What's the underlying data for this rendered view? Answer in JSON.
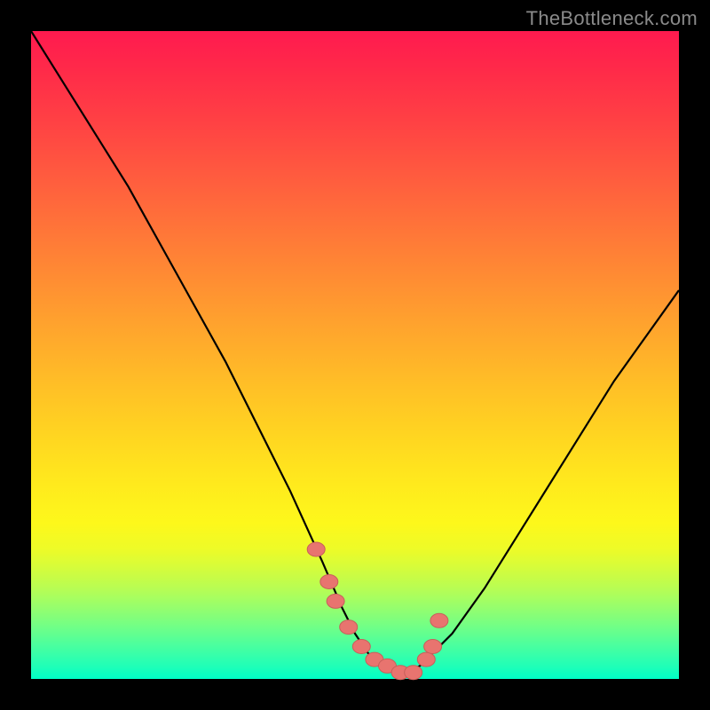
{
  "watermark": "TheBottleneck.com",
  "colors": {
    "curve_stroke": "#000000",
    "marker_fill": "#e8746f",
    "marker_stroke": "#c75f5a",
    "frame_bg": "#000000"
  },
  "chart_data": {
    "type": "line",
    "title": "",
    "xlabel": "",
    "ylabel": "",
    "xlim": [
      0,
      100
    ],
    "ylim": [
      0,
      100
    ],
    "series": [
      {
        "name": "bottleneck-curve",
        "x": [
          0,
          5,
          10,
          15,
          20,
          25,
          30,
          35,
          40,
          45,
          48,
          50,
          52,
          54,
          56,
          58,
          60,
          65,
          70,
          75,
          80,
          85,
          90,
          95,
          100
        ],
        "y": [
          100,
          92,
          84,
          76,
          67,
          58,
          49,
          39,
          29,
          18,
          11,
          7,
          4,
          2,
          1,
          1,
          2,
          7,
          14,
          22,
          30,
          38,
          46,
          53,
          60
        ]
      }
    ],
    "markers": {
      "name": "highlighted-points",
      "x": [
        44,
        46,
        47,
        49,
        51,
        53,
        55,
        57,
        59,
        61,
        62,
        63
      ],
      "y": [
        20,
        15,
        12,
        8,
        5,
        3,
        2,
        1,
        1,
        3,
        5,
        9
      ]
    }
  }
}
